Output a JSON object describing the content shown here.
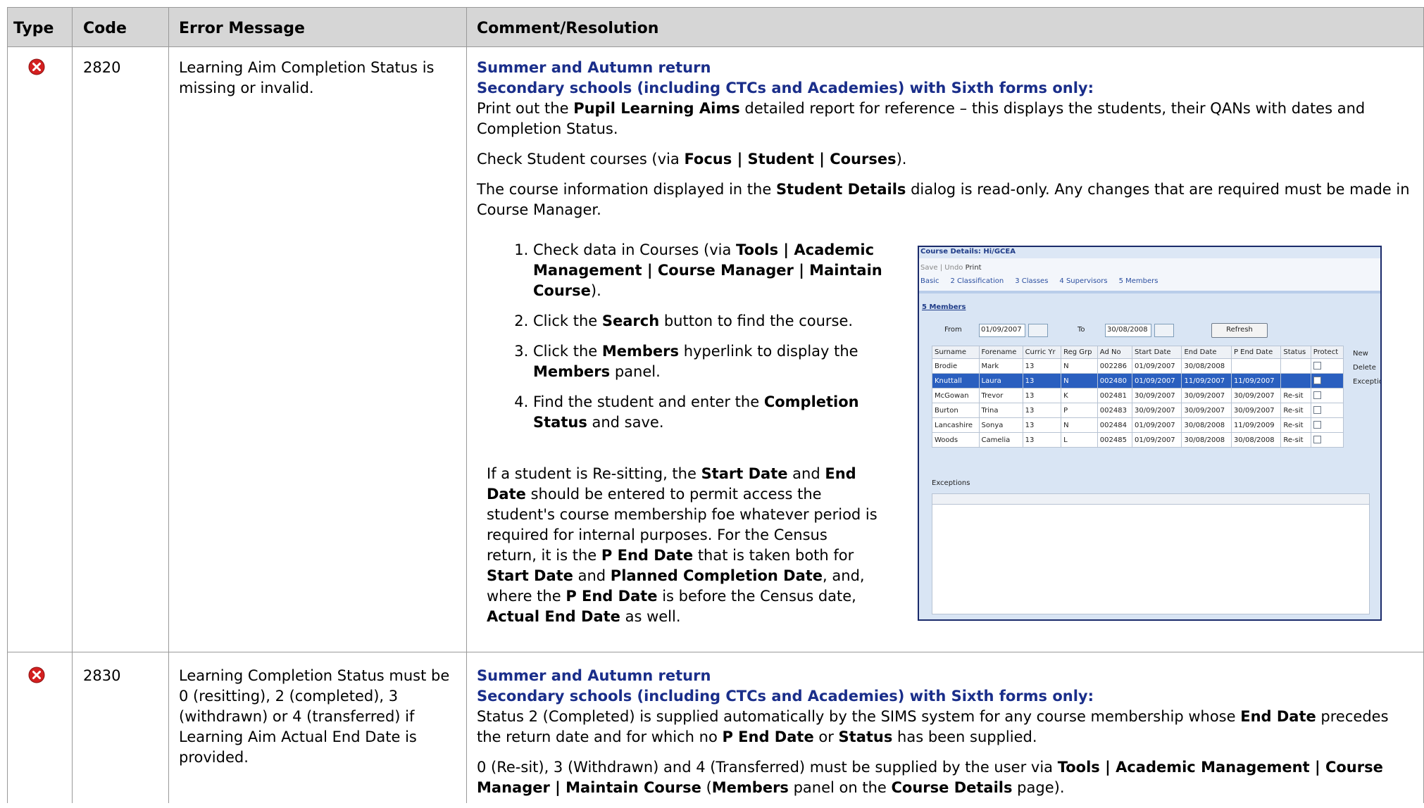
{
  "headers": {
    "type": "Type",
    "code": "Code",
    "message": "Error Message",
    "comment": "Comment/Resolution"
  },
  "rows": [
    {
      "code": "2820",
      "message": "Learning Aim Completion Status is missing or invalid.",
      "heading1": "Summer and Autumn return",
      "heading2": "Secondary schools (including CTCs and Academies) with Sixth forms only:",
      "p1": [
        "Print out the ",
        "Pupil Learning Aims",
        " detailed report for reference – this displays the students, their QANs with dates and Completion Status."
      ],
      "p2": [
        "Check Student courses (via ",
        "Focus | Student | Courses",
        ")."
      ],
      "p3": [
        "The course information displayed in the ",
        "Student Details",
        " dialog is read-only. Any changes that are required must be made in Course Manager."
      ],
      "step1": [
        "Check data in Courses (via ",
        "Tools | Academic Management | Course Manager | Maintain Course",
        ")."
      ],
      "step2": [
        "Click the ",
        "Search",
        " button to find the course."
      ],
      "step3": [
        "Click the ",
        "Members",
        " hyperlink to display the ",
        "Members",
        " panel."
      ],
      "step4": [
        "Find the student and enter the ",
        "Completion Status",
        " and save."
      ],
      "note": [
        "If a student is Re-sitting, the ",
        "Start Date",
        " and ",
        "End Date",
        " should be entered to permit access the student's course membership foe whatever period is required for internal purposes. For the Census return, it is the ",
        "P End Date",
        " that is taken both for ",
        "Start Date",
        " and ",
        "Planned Completion Date",
        ", and, where the ",
        "P End Date",
        " is before the Census date, ",
        "Actual End Date",
        " as well."
      ]
    },
    {
      "code": "2830",
      "message": "Learning Completion Status must be 0 (resitting), 2 (completed), 3 (withdrawn) or 4 (transferred) if Learning Aim Actual End Date is provided.",
      "heading1": "Summer and Autumn return",
      "heading2": "Secondary schools (including CTCs and Academies) with Sixth forms only:",
      "p1": [
        "Status 2 (Completed) is supplied automatically by the SIMS system for any course membership whose ",
        "End Date",
        " precedes the return date and for which no ",
        "P End Date",
        " or ",
        "Status",
        " has been supplied."
      ],
      "p2": [
        "0 (Re-sit), 3 (Withdrawn) and 4 (Transferred) must be supplied by the user via ",
        "Tools | Academic Management | Course Manager | Maintain Course",
        " (",
        "Members",
        " panel on the ",
        "Course Details",
        " page)."
      ]
    }
  ],
  "screenshot": {
    "title": "Course Details: Hi/GCEA",
    "toolbar": {
      "save": "Save",
      "undo": "Undo",
      "print": "Print"
    },
    "tabs": [
      "Basic",
      "2 Classification",
      "3 Classes",
      "4 Supervisors",
      "5 Members"
    ],
    "section": "5 Members",
    "from_label": "From",
    "from_value": "01/09/2007",
    "to_label": "To",
    "to_value": "30/08/2008",
    "refresh": "Refresh",
    "columns": [
      "Surname",
      "Forename",
      "Curric Yr",
      "Reg Grp",
      "Ad No",
      "Start Date",
      "End Date",
      "P End Date",
      "Status",
      "Protect"
    ],
    "members": [
      [
        "Brodie",
        "Mark",
        "13",
        "N",
        "002286",
        "01/09/2007",
        "30/08/2008",
        "",
        ""
      ],
      [
        "Knuttall",
        "Laura",
        "13",
        "N",
        "002480",
        "01/09/2007",
        "11/09/2007",
        "11/09/2007",
        ""
      ],
      [
        "McGowan",
        "Trevor",
        "13",
        "K",
        "002481",
        "30/09/2007",
        "30/09/2007",
        "30/09/2007",
        "Re-sit"
      ],
      [
        "Burton",
        "Trina",
        "13",
        "P",
        "002483",
        "30/09/2007",
        "30/09/2007",
        "30/09/2007",
        "Re-sit"
      ],
      [
        "Lancashire",
        "Sonya",
        "13",
        "N",
        "002484",
        "01/09/2007",
        "30/08/2008",
        "11/09/2009",
        "Re-sit"
      ],
      [
        "Woods",
        "Camelia",
        "13",
        "L",
        "002485",
        "01/09/2007",
        "30/08/2008",
        "30/08/2008",
        "Re-sit"
      ]
    ],
    "selected_row": 1,
    "actions": {
      "new": "New",
      "delete": "Delete",
      "exception": "Exception"
    },
    "exceptions_label": "Exceptions"
  },
  "colors": {
    "header_bg": "#d6d6d6",
    "heading_blue": "#1a2e8a",
    "error_red": "#d42020"
  }
}
